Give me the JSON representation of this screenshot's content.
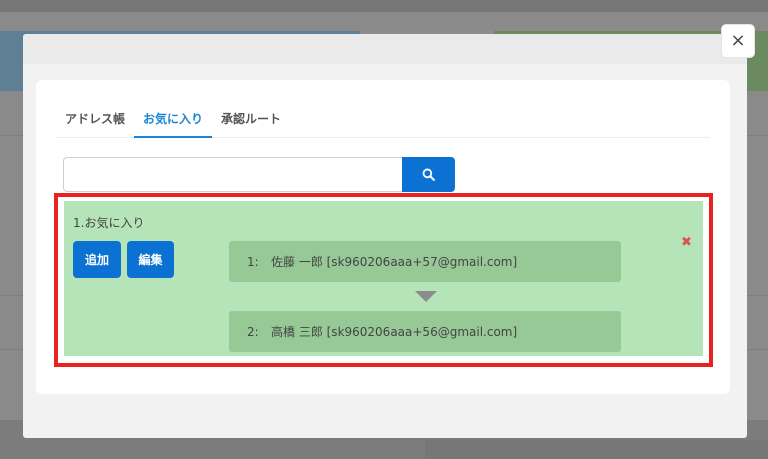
{
  "modal": {
    "close_label": "×"
  },
  "tabs": [
    {
      "label": "アドレス帳",
      "active": false
    },
    {
      "label": "お気に入り",
      "active": true
    },
    {
      "label": "承認ルート",
      "active": false
    }
  ],
  "search": {
    "value": "",
    "placeholder": "",
    "button_icon": "search-icon"
  },
  "favorite_group": {
    "title": "1.お気に入り",
    "add_label": "追加",
    "edit_label": "編集",
    "remove_icon": "close-x-icon",
    "members": [
      {
        "index": "1:",
        "text": "佐藤 一郎 [sk960206aaa+57@gmail.com]"
      },
      {
        "index": "2:",
        "text": "高橋 三郎 [sk960206aaa+56@gmail.com]"
      }
    ]
  },
  "colors": {
    "accent": "#0b72d3",
    "group_bg": "#b5e4b8",
    "member_bg": "#97c997",
    "highlight": "#e8221f"
  }
}
